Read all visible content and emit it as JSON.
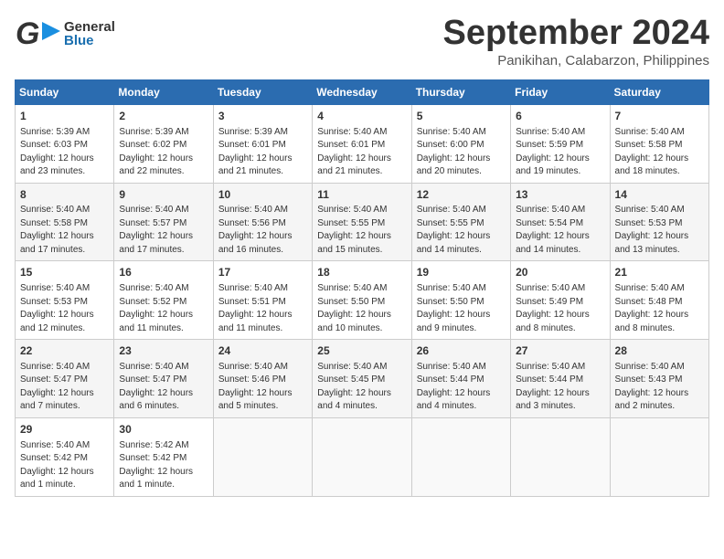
{
  "header": {
    "logo_general": "General",
    "logo_blue": "Blue",
    "month": "September 2024",
    "location": "Panikihan, Calabarzon, Philippines"
  },
  "calendar": {
    "days_of_week": [
      "Sunday",
      "Monday",
      "Tuesday",
      "Wednesday",
      "Thursday",
      "Friday",
      "Saturday"
    ],
    "weeks": [
      [
        null,
        null,
        null,
        null,
        null,
        null,
        null
      ]
    ]
  },
  "cells": {
    "w1": [
      {
        "day": "",
        "info": ""
      },
      {
        "day": "",
        "info": ""
      },
      {
        "day": "",
        "info": ""
      },
      {
        "day": "",
        "info": ""
      },
      {
        "day": "",
        "info": ""
      },
      {
        "day": "",
        "info": ""
      },
      {
        "day": "",
        "info": ""
      }
    ]
  },
  "days": [
    {
      "num": "1",
      "sunrise": "Sunrise: 5:39 AM",
      "sunset": "Sunset: 6:03 PM",
      "daylight": "Daylight: 12 hours and 23 minutes."
    },
    {
      "num": "2",
      "sunrise": "Sunrise: 5:39 AM",
      "sunset": "Sunset: 6:02 PM",
      "daylight": "Daylight: 12 hours and 22 minutes."
    },
    {
      "num": "3",
      "sunrise": "Sunrise: 5:39 AM",
      "sunset": "Sunset: 6:01 PM",
      "daylight": "Daylight: 12 hours and 21 minutes."
    },
    {
      "num": "4",
      "sunrise": "Sunrise: 5:40 AM",
      "sunset": "Sunset: 6:01 PM",
      "daylight": "Daylight: 12 hours and 21 minutes."
    },
    {
      "num": "5",
      "sunrise": "Sunrise: 5:40 AM",
      "sunset": "Sunset: 6:00 PM",
      "daylight": "Daylight: 12 hours and 20 minutes."
    },
    {
      "num": "6",
      "sunrise": "Sunrise: 5:40 AM",
      "sunset": "Sunset: 5:59 PM",
      "daylight": "Daylight: 12 hours and 19 minutes."
    },
    {
      "num": "7",
      "sunrise": "Sunrise: 5:40 AM",
      "sunset": "Sunset: 5:58 PM",
      "daylight": "Daylight: 12 hours and 18 minutes."
    },
    {
      "num": "8",
      "sunrise": "Sunrise: 5:40 AM",
      "sunset": "Sunset: 5:58 PM",
      "daylight": "Daylight: 12 hours and 17 minutes."
    },
    {
      "num": "9",
      "sunrise": "Sunrise: 5:40 AM",
      "sunset": "Sunset: 5:57 PM",
      "daylight": "Daylight: 12 hours and 17 minutes."
    },
    {
      "num": "10",
      "sunrise": "Sunrise: 5:40 AM",
      "sunset": "Sunset: 5:56 PM",
      "daylight": "Daylight: 12 hours and 16 minutes."
    },
    {
      "num": "11",
      "sunrise": "Sunrise: 5:40 AM",
      "sunset": "Sunset: 5:55 PM",
      "daylight": "Daylight: 12 hours and 15 minutes."
    },
    {
      "num": "12",
      "sunrise": "Sunrise: 5:40 AM",
      "sunset": "Sunset: 5:55 PM",
      "daylight": "Daylight: 12 hours and 14 minutes."
    },
    {
      "num": "13",
      "sunrise": "Sunrise: 5:40 AM",
      "sunset": "Sunset: 5:54 PM",
      "daylight": "Daylight: 12 hours and 14 minutes."
    },
    {
      "num": "14",
      "sunrise": "Sunrise: 5:40 AM",
      "sunset": "Sunset: 5:53 PM",
      "daylight": "Daylight: 12 hours and 13 minutes."
    },
    {
      "num": "15",
      "sunrise": "Sunrise: 5:40 AM",
      "sunset": "Sunset: 5:53 PM",
      "daylight": "Daylight: 12 hours and 12 minutes."
    },
    {
      "num": "16",
      "sunrise": "Sunrise: 5:40 AM",
      "sunset": "Sunset: 5:52 PM",
      "daylight": "Daylight: 12 hours and 11 minutes."
    },
    {
      "num": "17",
      "sunrise": "Sunrise: 5:40 AM",
      "sunset": "Sunset: 5:51 PM",
      "daylight": "Daylight: 12 hours and 11 minutes."
    },
    {
      "num": "18",
      "sunrise": "Sunrise: 5:40 AM",
      "sunset": "Sunset: 5:50 PM",
      "daylight": "Daylight: 12 hours and 10 minutes."
    },
    {
      "num": "19",
      "sunrise": "Sunrise: 5:40 AM",
      "sunset": "Sunset: 5:50 PM",
      "daylight": "Daylight: 12 hours and 9 minutes."
    },
    {
      "num": "20",
      "sunrise": "Sunrise: 5:40 AM",
      "sunset": "Sunset: 5:49 PM",
      "daylight": "Daylight: 12 hours and 8 minutes."
    },
    {
      "num": "21",
      "sunrise": "Sunrise: 5:40 AM",
      "sunset": "Sunset: 5:48 PM",
      "daylight": "Daylight: 12 hours and 8 minutes."
    },
    {
      "num": "22",
      "sunrise": "Sunrise: 5:40 AM",
      "sunset": "Sunset: 5:47 PM",
      "daylight": "Daylight: 12 hours and 7 minutes."
    },
    {
      "num": "23",
      "sunrise": "Sunrise: 5:40 AM",
      "sunset": "Sunset: 5:47 PM",
      "daylight": "Daylight: 12 hours and 6 minutes."
    },
    {
      "num": "24",
      "sunrise": "Sunrise: 5:40 AM",
      "sunset": "Sunset: 5:46 PM",
      "daylight": "Daylight: 12 hours and 5 minutes."
    },
    {
      "num": "25",
      "sunrise": "Sunrise: 5:40 AM",
      "sunset": "Sunset: 5:45 PM",
      "daylight": "Daylight: 12 hours and 4 minutes."
    },
    {
      "num": "26",
      "sunrise": "Sunrise: 5:40 AM",
      "sunset": "Sunset: 5:44 PM",
      "daylight": "Daylight: 12 hours and 4 minutes."
    },
    {
      "num": "27",
      "sunrise": "Sunrise: 5:40 AM",
      "sunset": "Sunset: 5:44 PM",
      "daylight": "Daylight: 12 hours and 3 minutes."
    },
    {
      "num": "28",
      "sunrise": "Sunrise: 5:40 AM",
      "sunset": "Sunset: 5:43 PM",
      "daylight": "Daylight: 12 hours and 2 minutes."
    },
    {
      "num": "29",
      "sunrise": "Sunrise: 5:40 AM",
      "sunset": "Sunset: 5:42 PM",
      "daylight": "Daylight: 12 hours and 1 minute."
    },
    {
      "num": "30",
      "sunrise": "Sunrise: 5:42 AM",
      "sunset": "Sunset: 5:42 PM",
      "daylight": "Daylight: 12 hours and 1 minute."
    }
  ]
}
